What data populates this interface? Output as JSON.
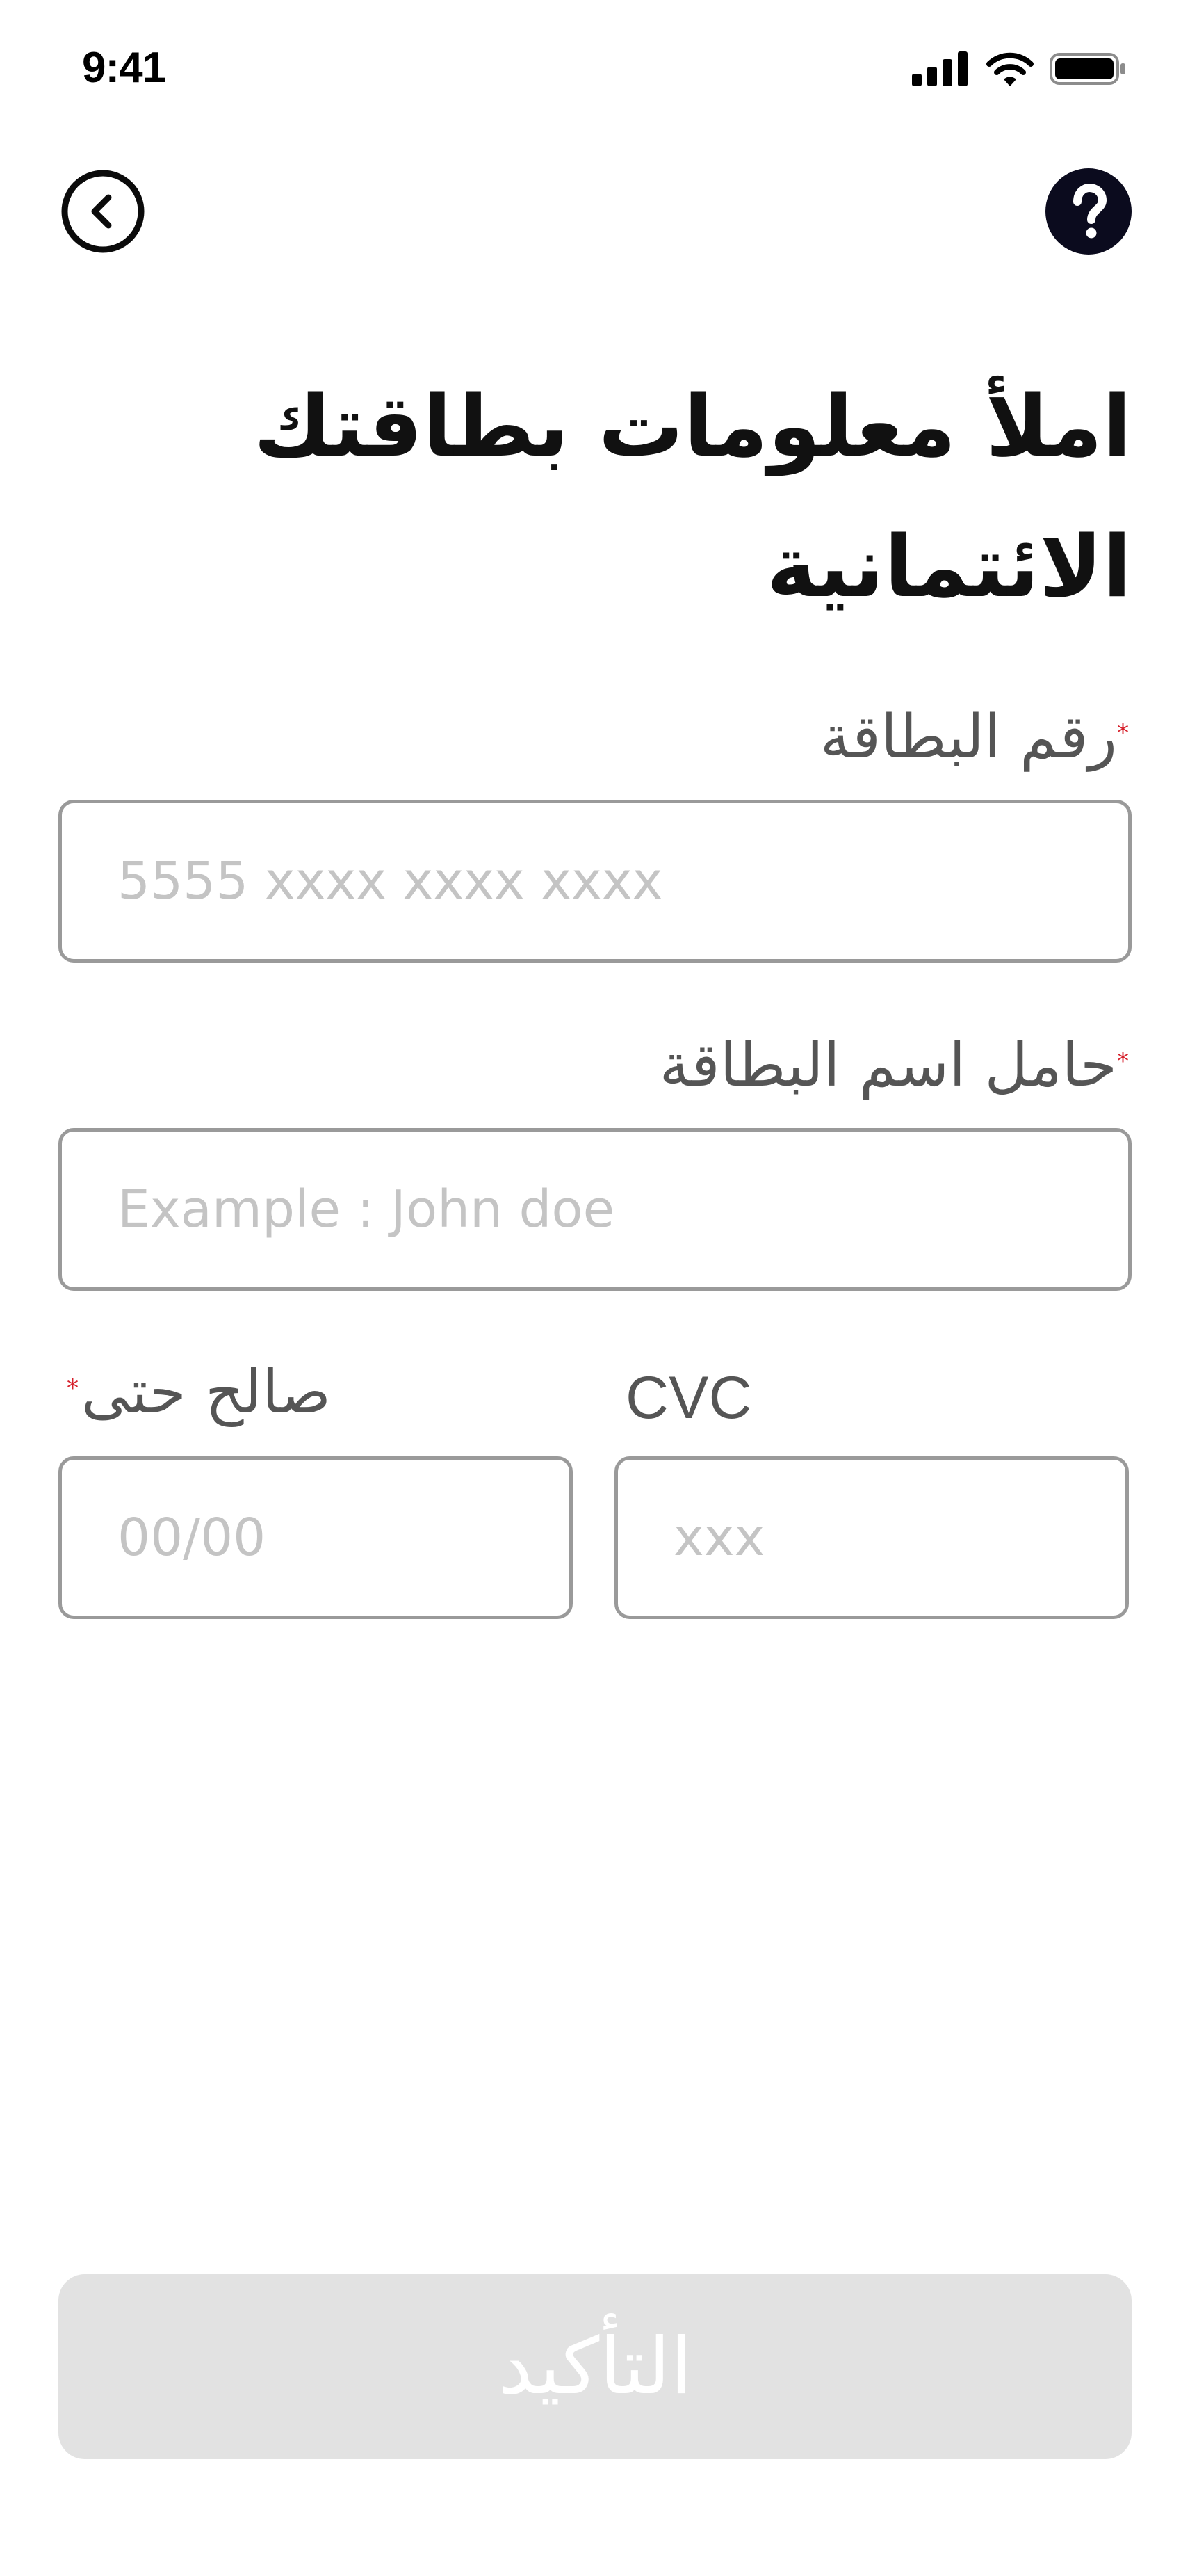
{
  "status_bar": {
    "time": "9:41"
  },
  "nav": {
    "back_icon": "chevron-left-circle-icon",
    "help_icon": "question-circle-icon"
  },
  "title": "املأ معلومات بطاقتك الائتمانية",
  "fields": {
    "card_number": {
      "label": "رقم البطاقة",
      "required_mark": "*",
      "placeholder": "5555 xxxx xxxx xxxx",
      "value": ""
    },
    "cardholder_name": {
      "label": "حامل اسم البطاقة",
      "required_mark": "*",
      "placeholder": "Example : John doe",
      "value": ""
    },
    "expiry": {
      "label": "صالح حتى",
      "required_mark": "*",
      "placeholder": "00/00",
      "value": ""
    },
    "cvc": {
      "label": "CVC",
      "placeholder": "xxx",
      "value": ""
    }
  },
  "confirm_button": {
    "label": "التأكيد",
    "enabled": false
  },
  "colors": {
    "required": "#d6202b",
    "disabled_button": "#e2e2e2",
    "border": "#9a9a9a",
    "placeholder": "#c4c4c4"
  }
}
